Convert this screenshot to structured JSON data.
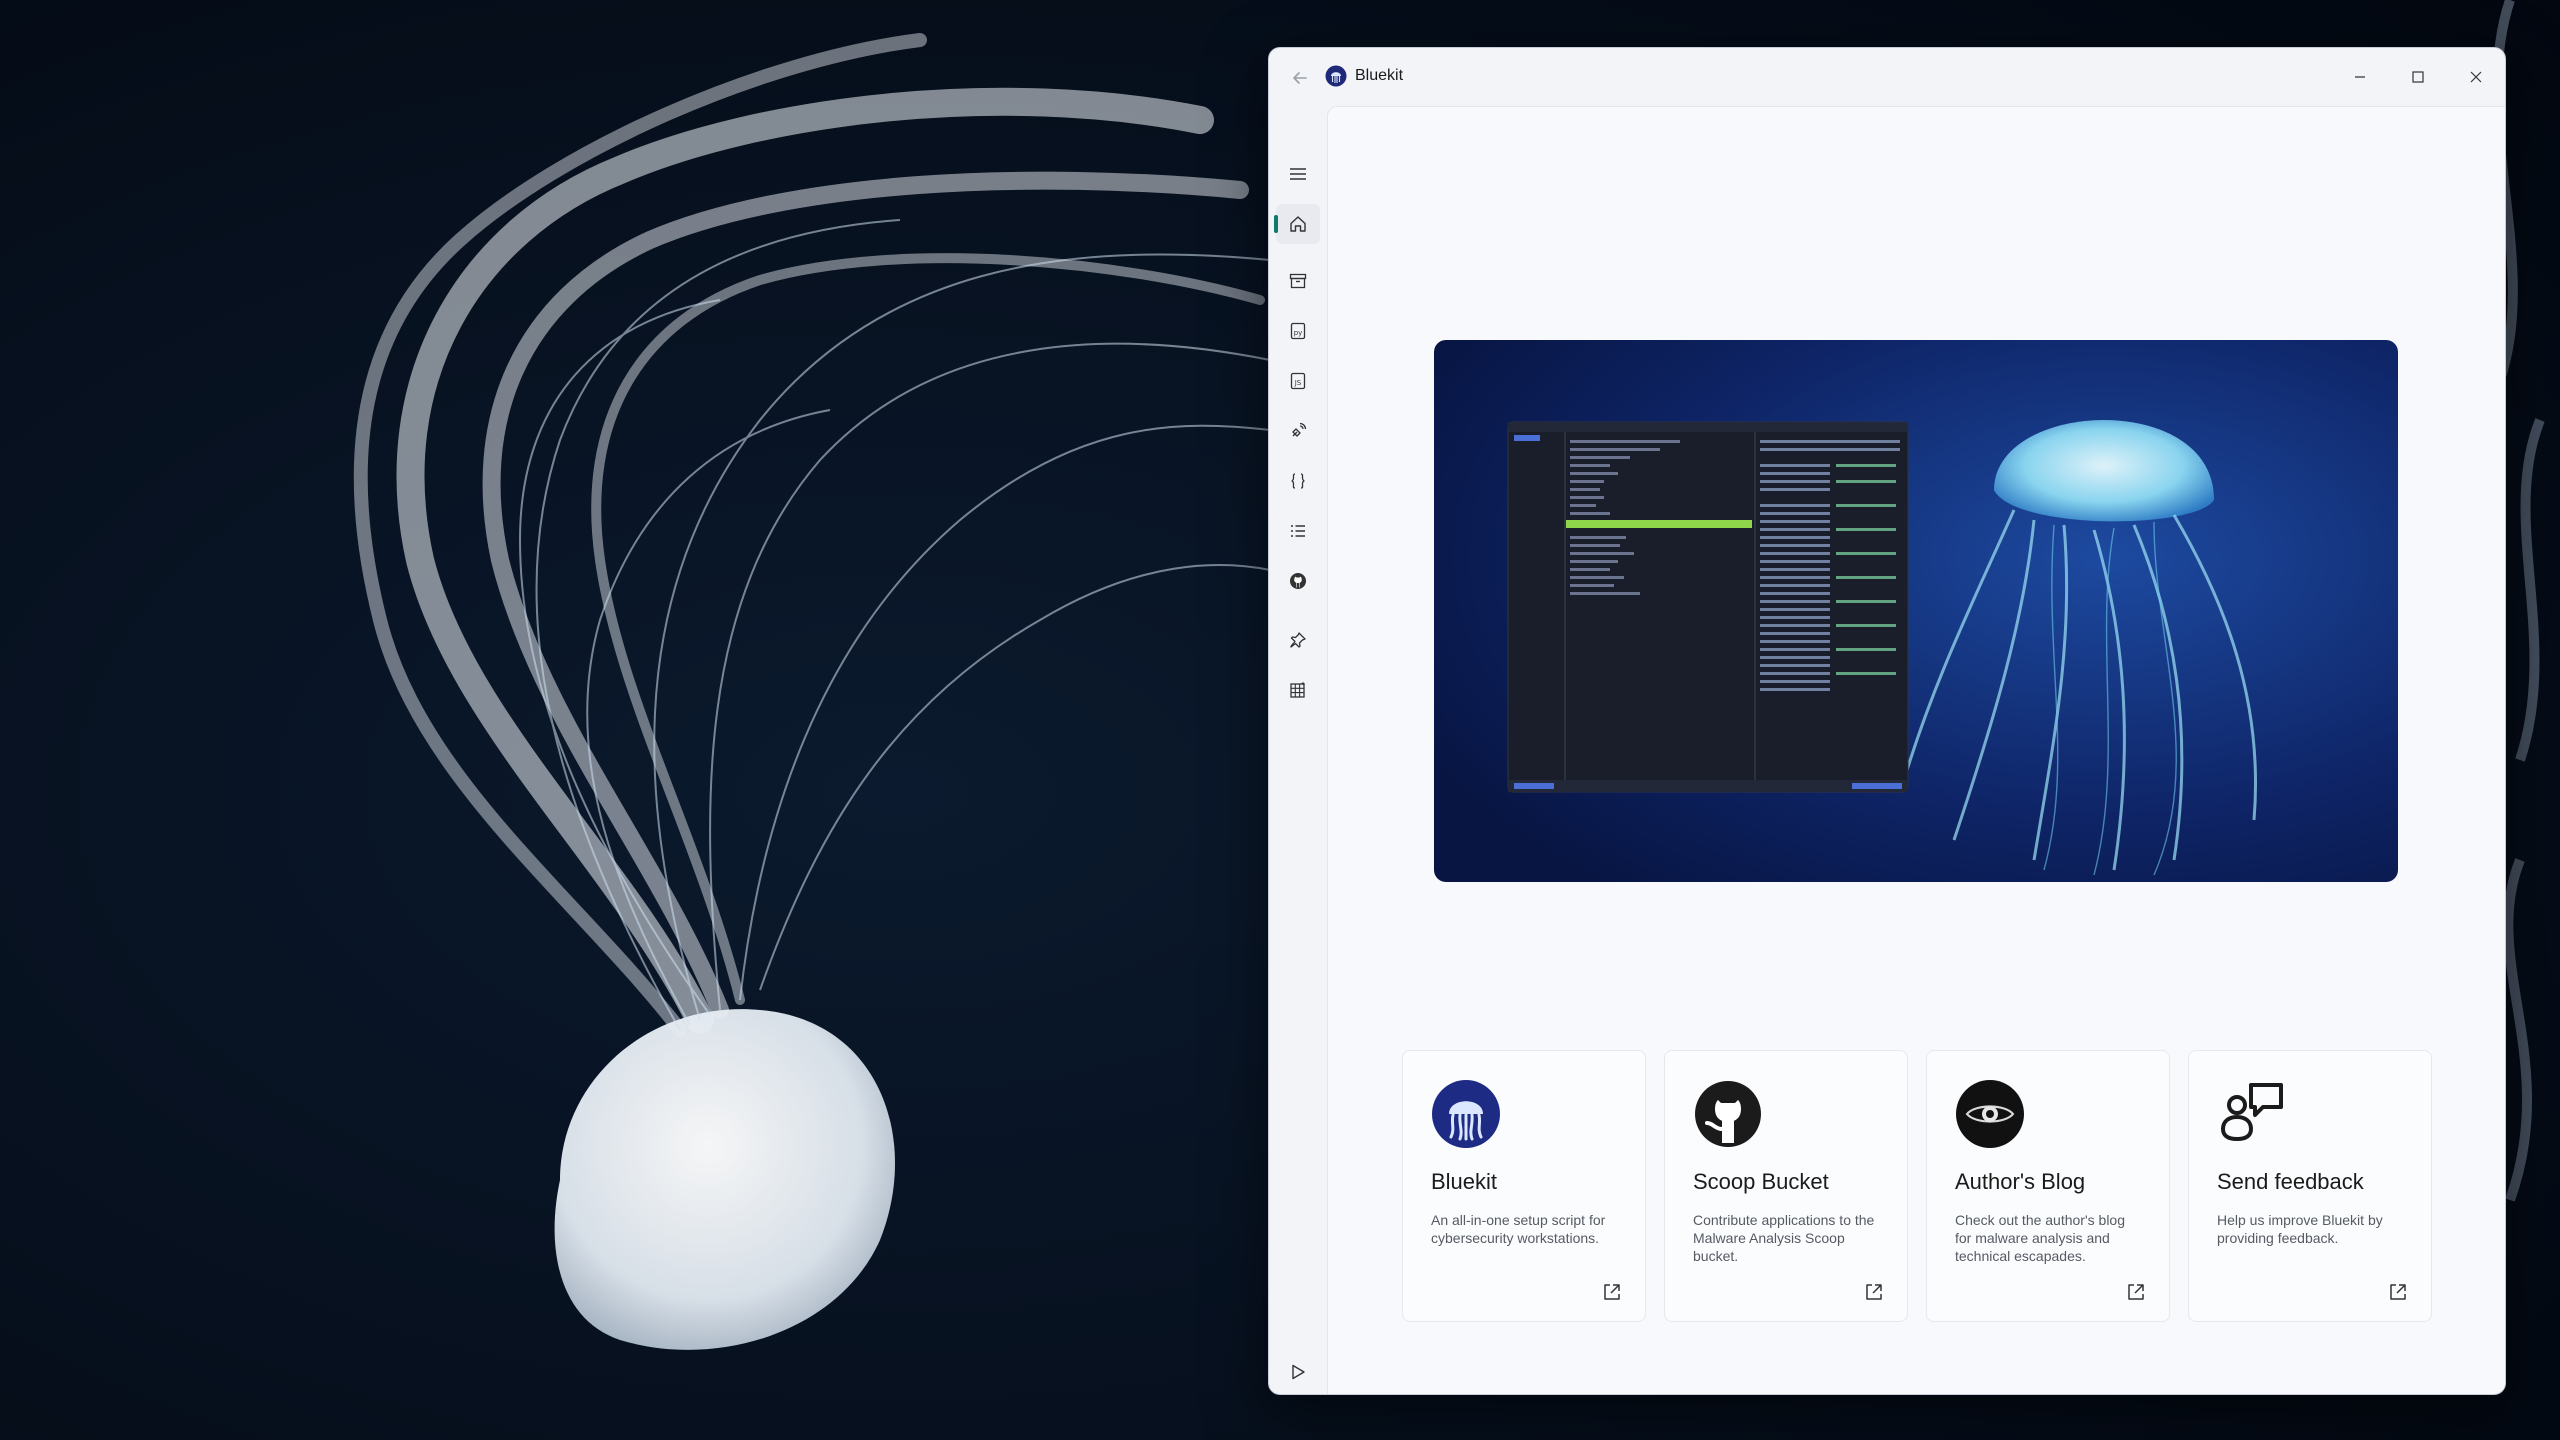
{
  "window": {
    "title": "Bluekit",
    "controls": [
      "minimize-icon",
      "maximize-icon",
      "close-icon"
    ]
  },
  "nav": {
    "items": [
      {
        "name": "home",
        "icon": "home-icon",
        "selected": true
      },
      {
        "name": "archive",
        "icon": "archive-icon"
      },
      {
        "name": "python",
        "icon": "python-file-icon"
      },
      {
        "name": "javascript",
        "icon": "js-file-icon"
      },
      {
        "name": "tools",
        "icon": "satellite-icon"
      },
      {
        "name": "json",
        "icon": "braces-icon"
      },
      {
        "name": "list",
        "icon": "checklist-icon"
      },
      {
        "name": "github",
        "icon": "github-icon"
      },
      {
        "name": "pin",
        "icon": "pin-icon"
      },
      {
        "name": "table",
        "icon": "grid-icon"
      }
    ],
    "run_icon": "play-icon"
  },
  "cards": [
    {
      "title": "Bluekit",
      "description": "An all-in-one setup script for cybersecurity workstations.",
      "icon": "bluekit-logo-icon"
    },
    {
      "title": "Scoop Bucket",
      "description": "Contribute applications to the Malware Analysis Scoop bucket.",
      "icon": "github-icon"
    },
    {
      "title": "Author's Blog",
      "description": "Check out the author's blog for malware analysis and technical escapades.",
      "icon": "eye-icon"
    },
    {
      "title": "Send feedback",
      "description": "Help us improve Bluekit by providing feedback.",
      "icon": "feedback-icon"
    }
  ],
  "colors": {
    "accent": "#0f7b6c",
    "window_bg": "#f3f4f8",
    "content_bg": "#f7f9fc"
  }
}
